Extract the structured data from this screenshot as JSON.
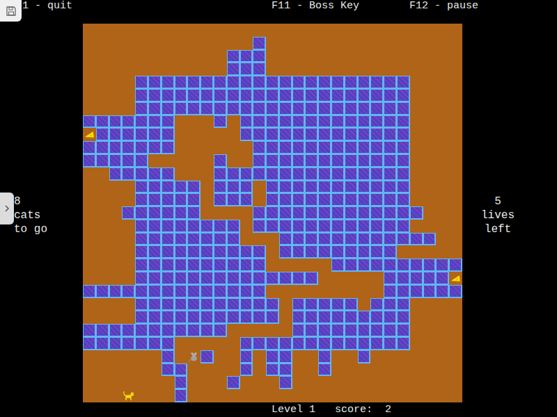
{
  "header": {
    "quit": "1 - quit",
    "boss_key": "F11 - Boss Key",
    "pause": "F12 - pause"
  },
  "cats_left": {
    "count": "8",
    "lines": [
      "cats",
      "to go"
    ]
  },
  "lives": {
    "count": "5",
    "lines": [
      "lives",
      "left"
    ]
  },
  "board": {
    "rows": [
      ".............................",
      ".............#...............",
      "...........###...............",
      "...........###...............",
      "....#####################....",
      "....#####################....",
      "....#####################....",
      "#######...#.#############....",
      "C######.....#############....",
      "#######......############....",
      "#####.....#..############....",
      "..#####...###############....",
      "....#####.###.###########....",
      "....#####.###.###########....",
      "...######....#############...",
      "....########.############....",
      "....########...############..",
      "....##########.#########.....",
      "....##########.....##########",
      "....##############.....#####C",
      "##############.........######",
      "....###########.#####.###....",
      "....###########.#########....",
      "###########.....#########....",
      "#######.....#############....",
      "......#.M#..#.##..#..#.......",
      "......##....#.##..#..........",
      ".......#...#...#.............",
      "...K...#....................."
    ]
  },
  "status": {
    "level": "Level 1",
    "score_label": "score:",
    "score": "2"
  }
}
